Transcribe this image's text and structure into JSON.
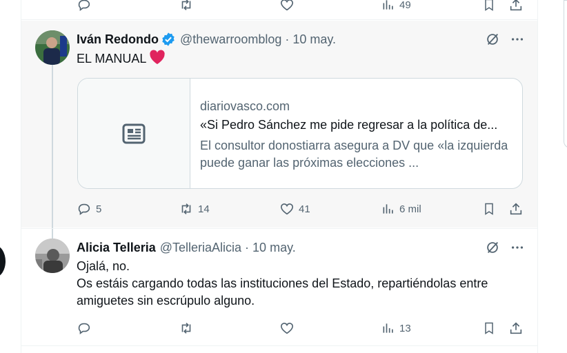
{
  "previous_tweet": {
    "views": "49"
  },
  "tweets": [
    {
      "name": "Iván Redondo",
      "verified": true,
      "handle": "@thewarroomblog",
      "separator": "·",
      "time": "10 may.",
      "text": "EL MANUAL",
      "emoji": "red-heart",
      "card": {
        "domain": "diariovasco.com",
        "title": "«Si Pedro Sánchez me pide regresar a la política de...",
        "description": "El consultor donostiarra asegura a DV que «la izquierda puede ganar las próximas elecciones ..."
      },
      "stats": {
        "replies": "5",
        "retweets": "14",
        "likes": "41",
        "views": "6 mil"
      }
    },
    {
      "name": "Alicia Telleria",
      "verified": false,
      "handle": "@TelleriaAlicia",
      "separator": "·",
      "time": "10 may.",
      "text_line1": "Ojalá, no.",
      "text_line2": "Os estáis cargando todas las instituciones del Estado, repartiéndolas entre amiguetes sin escrúpulo alguno.",
      "stats": {
        "replies": "",
        "retweets": "",
        "likes": "",
        "views": "13"
      }
    }
  ],
  "colors": {
    "accent": "#1d9bf0",
    "muted": "#536471",
    "heart": "#f91880"
  }
}
